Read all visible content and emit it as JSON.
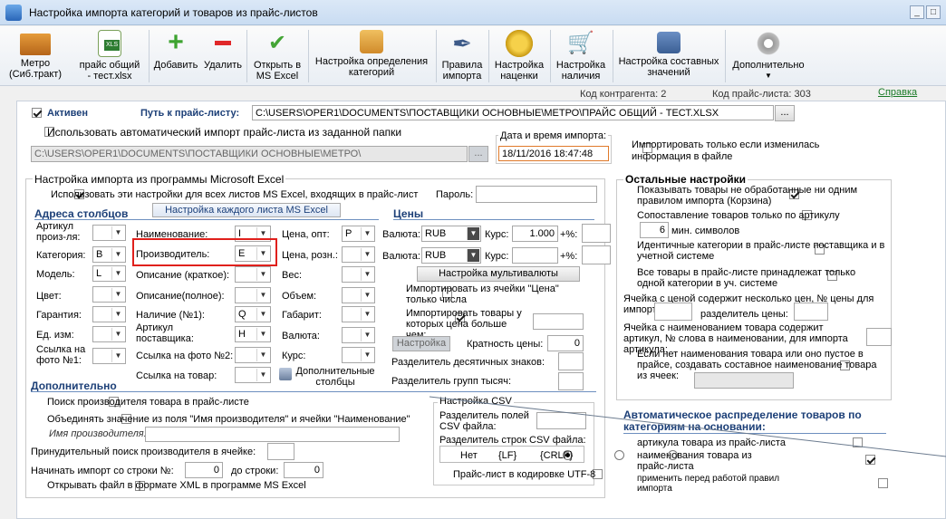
{
  "window": {
    "title": "Настройка импорта категорий и товаров из прайс-листов",
    "min": "_",
    "max": "□",
    "close": "X"
  },
  "toolbar": {
    "metro": [
      "Метро",
      "(Сиб.тракт)"
    ],
    "price": [
      "прайс общий",
      "- тест.xlsx"
    ],
    "add": "Добавить",
    "remove": "Удалить",
    "open_excel": [
      "Открыть в",
      "MS Excel"
    ],
    "define_cats": [
      "Настройка определения",
      "категорий"
    ],
    "rules": [
      "Правила",
      "импорта"
    ],
    "markup": [
      "Настройка",
      "наценки"
    ],
    "stock": [
      "Настройка",
      "наличия"
    ],
    "compound": [
      "Настройка составных",
      "значений"
    ],
    "more": "Дополнительно",
    "xls_badge": "XLS"
  },
  "info": {
    "contractor_code": "Код контрагента: 2",
    "price_code": "Код прайс-листа: 303",
    "help": "Справка"
  },
  "top": {
    "active_label": "Активен",
    "path_label": "Путь к прайс-листу:",
    "path_value": "C:\\USERS\\OPER1\\DOCUMENTS\\ПОСТАВЩИКИ ОСНОВНЫЕ\\МЕТРО\\ПРАЙС ОБЩИЙ - ТЕСТ.XLSX",
    "browse": "...",
    "auto_import_label": "Использовать автоматический импорт прайс-листа из заданной папки",
    "folder_value": "C:\\USERS\\OPER1\\DOCUMENTS\\ПОСТАВЩИКИ ОСНОВНЫЕ\\МЕТРО\\",
    "datetime_label": "Дата и время импорта:",
    "datetime_value": "18/11/2016 18:47:48",
    "only_changed": "Импортировать только если изменилась информация в файле"
  },
  "excel": {
    "group_title": "Настройка импорта из программы Microsoft Excel",
    "use_all_sheets": "Использовать эти настройки для всех листов MS Excel, входящих в прайс-лист",
    "password_label": "Пароль:",
    "each_sheet_btn": "Настройка каждого листа MS Excel",
    "addr_title": "Адреса столбцов",
    "prices_title": "Цены",
    "col1": [
      {
        "label": "Артикул произ-ля:",
        "value": ""
      },
      {
        "label": "Категория:",
        "value": "B"
      },
      {
        "label": "Модель:",
        "value": "L"
      },
      {
        "label": "Цвет:",
        "value": ""
      },
      {
        "label": "Гарантия:",
        "value": ""
      },
      {
        "label": "Ед. изм:",
        "value": ""
      },
      {
        "label": "Ссылка на фото №1:",
        "value": ""
      }
    ],
    "col2": [
      {
        "label": "Наименование:",
        "value": "I"
      },
      {
        "label": "Производитель:",
        "value": "E"
      },
      {
        "label": "Описание (краткое):",
        "value": ""
      },
      {
        "label": "Описание(полное):",
        "value": ""
      },
      {
        "label": "Наличие (№1):",
        "value": "Q"
      },
      {
        "label": "Артикул поставщика:",
        "value": "H"
      },
      {
        "label": "Ссылка на фото №2:",
        "value": ""
      },
      {
        "label": "Ссылка на товар:",
        "value": ""
      }
    ],
    "col3": [
      {
        "label": "Цена, опт:",
        "value": "P"
      },
      {
        "label": "Цена, розн.:",
        "value": ""
      },
      {
        "label": "Вес:",
        "value": ""
      },
      {
        "label": "Объем:",
        "value": ""
      },
      {
        "label": "Габарит:",
        "value": ""
      },
      {
        "label": "Валюта:",
        "value": ""
      },
      {
        "label": "Курс:",
        "value": ""
      }
    ],
    "extra_cols": [
      "Дополнительные",
      "столбцы"
    ],
    "prices": {
      "currency_label": "Валюта:",
      "currency1": "RUB",
      "currency2": "RUB",
      "rate_label": "Курс:",
      "rate1": "1.000",
      "rate2": "",
      "pct_label": "+%:",
      "multicurrency_btn": "Настройка мультивалюты",
      "import_from_price_cell": "Импортировать из ячейки \"Цена\" только числа",
      "import_price_greater": "Импортировать товары у которых цена больше чем:",
      "setup_btn": "Настройка",
      "multiplicity_label": "Кратность цены:",
      "multiplicity_value": "0",
      "decimal_sep": "Разделитель десятичных знаков:",
      "thousand_sep": "Разделитель групп тысяч:"
    },
    "extra": {
      "title": "Дополнительно",
      "search_mfr": "Поиск производителя товара в прайс-листе",
      "merge_mfr": "Объединять значение из поля \"Имя производителя\" и ячейки \"Наименование\"",
      "mfr_name_label": "Имя производителя:",
      "force_search": "Принудительный поиск производителя в ячейке:",
      "start_row_label": "Начинать импорт со строки №:",
      "start_row": "0",
      "to_row_label": "до строки:",
      "to_row": "0",
      "xml_open": "Открывать файл в формате XML в программе MS Excel"
    },
    "csv": {
      "title": "Настройка CSV",
      "field_sep": "Разделитель полей CSV файла:",
      "row_sep": "Разделитель строк CSV файла:",
      "opt_none": "Нет",
      "opt_lf": "{LF}",
      "opt_crlf": "{CRLF}",
      "utf8": "Прайс-лист в кодировке UTF-8"
    }
  },
  "other": {
    "title": "Остальные настройки",
    "show_unprocessed": "Показывать товары не обработанные ни одним правилом импорта (Корзина)",
    "match_by_article": "Сопоставление товаров только по артикулу",
    "min_symbols_value": "6",
    "min_symbols_label": "мин. символов",
    "identical_cats": "Идентичные категории в прайс-листе поставщика и в учетной системе",
    "all_one_cat": "Все товары в прайс-листе принадлежат только одной категории в уч. системе",
    "multi_price_cell": "Ячейка с ценой содержит несколько цен, № цены для импорта:",
    "price_sep_label": "разделитель цены:",
    "name_cell_article": "Ячейка с наименованием товара содержит артикул, № слова в наименовании, для импорта артикула:",
    "compound_name": "Если нет наименования товара или оно пустое в прайсе, создавать составное наименование товара из ячеек:"
  },
  "auto": {
    "title": "Автоматическое распределение товаров по категориям на основании:",
    "by_article": "артикула товара из прайс-листа",
    "by_name": "наименования товара из прайс-листа",
    "apply_rules": "применить перед работой правил импорта"
  }
}
